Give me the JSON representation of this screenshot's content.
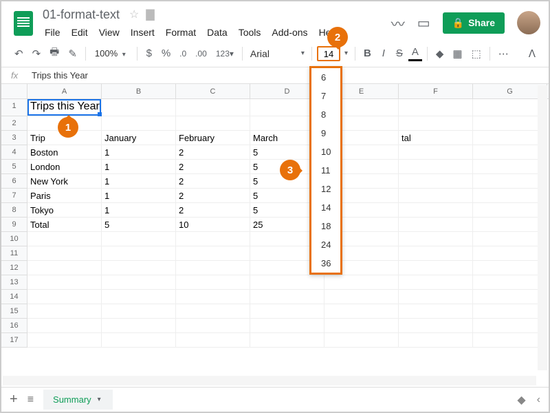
{
  "doc": {
    "title": "01-format-text"
  },
  "menu": {
    "file": "File",
    "edit": "Edit",
    "view": "View",
    "insert": "Insert",
    "format": "Format",
    "data": "Data",
    "tools": "Tools",
    "addons": "Add-ons",
    "help": "Help"
  },
  "share": {
    "label": "Share"
  },
  "toolbar": {
    "zoom": "100%",
    "currency": "$",
    "percent": "%",
    "dec_dec": ".0",
    "dec_inc": ".00",
    "numfmt": "123",
    "font": "Arial",
    "font_size": "14",
    "bold": "B",
    "italic": "I",
    "strike": "S",
    "textcolor": "A"
  },
  "fx": {
    "label": "fx",
    "value": "Trips this Year"
  },
  "columns": [
    "A",
    "B",
    "C",
    "D",
    "E",
    "F",
    "G"
  ],
  "rows": [
    {
      "n": "1",
      "cells": [
        "Trips this Year",
        "",
        "",
        "",
        "",
        "",
        ""
      ]
    },
    {
      "n": "2",
      "cells": [
        "",
        "",
        "",
        "",
        "",
        "",
        ""
      ]
    },
    {
      "n": "3",
      "cells": [
        "Trip",
        "January",
        "February",
        "March",
        "",
        "tal",
        ""
      ]
    },
    {
      "n": "4",
      "cells": [
        "Boston",
        "1",
        "2",
        "5",
        "",
        "",
        ""
      ]
    },
    {
      "n": "5",
      "cells": [
        "London",
        "1",
        "2",
        "5",
        "",
        "",
        ""
      ]
    },
    {
      "n": "6",
      "cells": [
        "New York",
        "1",
        "2",
        "5",
        "",
        "",
        ""
      ]
    },
    {
      "n": "7",
      "cells": [
        "Paris",
        "1",
        "2",
        "5",
        "",
        "",
        ""
      ]
    },
    {
      "n": "8",
      "cells": [
        "Tokyo",
        "1",
        "2",
        "5",
        "",
        "",
        ""
      ]
    },
    {
      "n": "9",
      "cells": [
        "Total",
        "5",
        "10",
        "25",
        "",
        "",
        ""
      ]
    },
    {
      "n": "10",
      "cells": [
        "",
        "",
        "",
        "",
        "",
        "",
        ""
      ]
    },
    {
      "n": "11",
      "cells": [
        "",
        "",
        "",
        "",
        "",
        "",
        ""
      ]
    },
    {
      "n": "12",
      "cells": [
        "",
        "",
        "",
        "",
        "",
        "",
        ""
      ]
    },
    {
      "n": "13",
      "cells": [
        "",
        "",
        "",
        "",
        "",
        "",
        ""
      ]
    },
    {
      "n": "14",
      "cells": [
        "",
        "",
        "",
        "",
        "",
        "",
        ""
      ]
    },
    {
      "n": "15",
      "cells": [
        "",
        "",
        "",
        "",
        "",
        "",
        ""
      ]
    },
    {
      "n": "16",
      "cells": [
        "",
        "",
        "",
        "",
        "",
        "",
        ""
      ]
    },
    {
      "n": "17",
      "cells": [
        "",
        "",
        "",
        "",
        "",
        "",
        ""
      ]
    }
  ],
  "font_sizes": [
    "6",
    "7",
    "8",
    "9",
    "10",
    "11",
    "12",
    "14",
    "18",
    "24",
    "36"
  ],
  "sheet": {
    "name": "Summary"
  },
  "callouts": {
    "c1": "1",
    "c2": "2",
    "c3": "3"
  }
}
